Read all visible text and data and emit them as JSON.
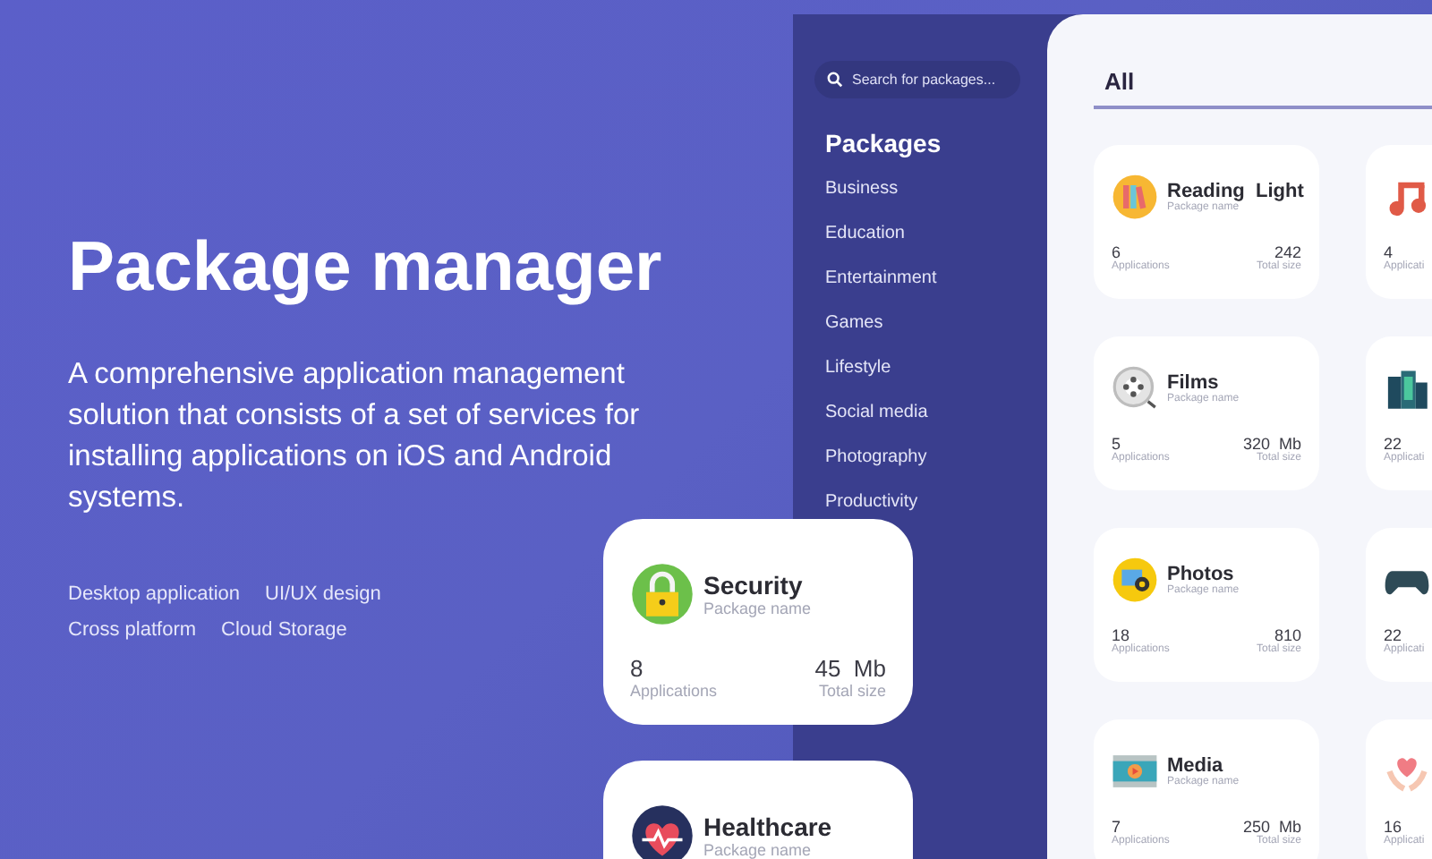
{
  "hero": {
    "title": "Package manager",
    "description": "A comprehensive application management solution that consists of a set of services for installing applications on iOS and Android systems.",
    "tags": [
      "Desktop application",
      "UI/UX design",
      "Cross platform",
      "Cloud Storage"
    ]
  },
  "sidebar": {
    "search": {
      "placeholder": "Search for packages..."
    },
    "heading": "Packages",
    "items": [
      "Business",
      "Education",
      "Entertainment",
      "Games",
      "Lifestyle",
      "Social media",
      "Photography",
      "Productivity"
    ]
  },
  "main": {
    "tab": "All",
    "cards": [
      {
        "kind": "books",
        "title": "Reading  Light",
        "subtitle": "Package name",
        "count": "6",
        "count_label": "Applications",
        "size": "242",
        "size_label": "Total size"
      },
      {
        "kind": "music",
        "count": "4",
        "count_label": "Applicati"
      },
      {
        "kind": "reel",
        "title": "Films",
        "subtitle": "Package name",
        "count": "5",
        "count_label": "Applications",
        "size": "320  Mb",
        "size_label": "Total size"
      },
      {
        "kind": "city",
        "count": "22",
        "count_label": "Applicati"
      },
      {
        "kind": "photo",
        "title": "Photos",
        "subtitle": "Package name",
        "count": "18",
        "count_label": "Applications",
        "size": "810",
        "size_label": "Total size"
      },
      {
        "kind": "gamepad",
        "count": "22",
        "count_label": "Applicati"
      },
      {
        "kind": "film",
        "title": "Media",
        "subtitle": "Package name",
        "count": "7",
        "count_label": "Applications",
        "size": "250  Mb",
        "size_label": "Total size"
      },
      {
        "kind": "heart",
        "count": "16",
        "count_label": "Applicati"
      }
    ]
  },
  "floating_cards": [
    {
      "kind": "lock",
      "title": "Security",
      "subtitle": "Package name",
      "count": "8",
      "count_label": "Applications",
      "size": "45  Mb",
      "size_label": "Total size"
    },
    {
      "kind": "pulse",
      "title": "Healthcare",
      "subtitle": "Package name"
    }
  ]
}
